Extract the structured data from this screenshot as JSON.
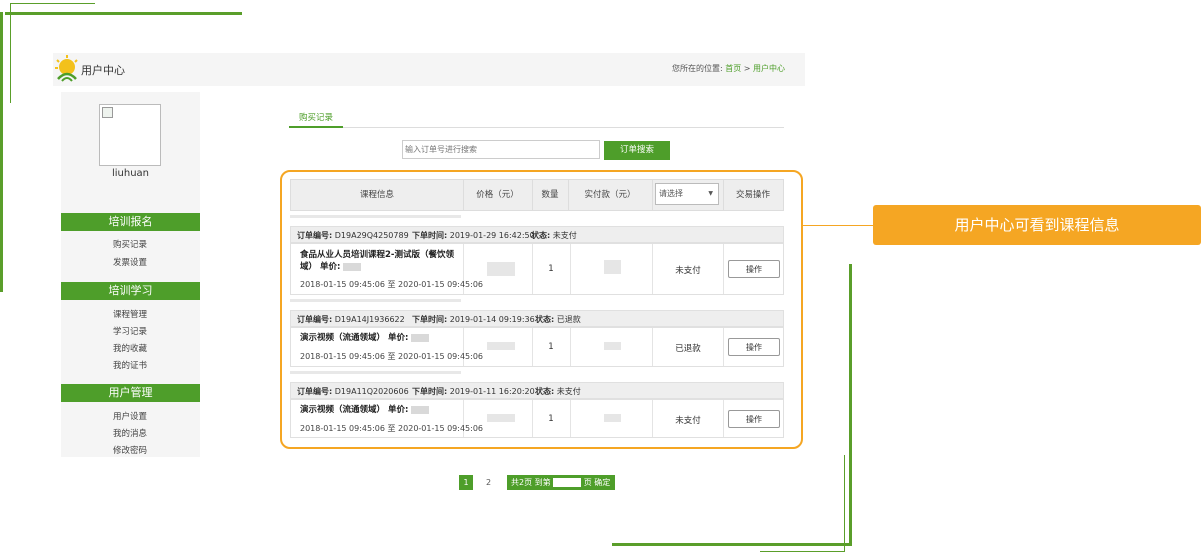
{
  "header": {
    "title": "用户中心",
    "breadcrumb_prefix": "您所在的位置:",
    "breadcrumb_home": "首页",
    "breadcrumb_sep": ">",
    "breadcrumb_current": "用户中心"
  },
  "sidebar": {
    "username": "liuhuan",
    "sections": [
      {
        "title": "培训报名",
        "items": [
          "购买记录",
          "发票设置"
        ]
      },
      {
        "title": "培训学习",
        "items": [
          "课程管理",
          "学习记录",
          "我的收藏",
          "我的证书"
        ]
      },
      {
        "title": "用户管理",
        "items": [
          "用户设置",
          "我的消息",
          "修改密码"
        ]
      }
    ]
  },
  "main": {
    "tab": "购买记录",
    "search_placeholder": "输入订单号进行搜索",
    "search_button": "订单搜索",
    "columns": [
      "课程信息",
      "价格（元）",
      "数量",
      "实付款（元）",
      "请选择",
      "交易操作"
    ],
    "orders": [
      {
        "order_label": "订单编号:",
        "order_no": "D19A29Q4250789",
        "time_label": "下单时间:",
        "time": "2019-01-29 16:42:50",
        "status_label": "状态:",
        "status": "未支付",
        "course_line1": "食品从业人员培训课程2-测试版（餐饮领",
        "course_line2": "域）",
        "unit_label": "单价:",
        "validity": "2018-01-15 09:45:06 至 2020-01-15 09:45:06",
        "qty": "1",
        "pay_status": "未支付",
        "action": "操作"
      },
      {
        "order_label": "订单编号:",
        "order_no": "D19A14J1936622",
        "time_label": "下单时间:",
        "time": "2019-01-14 09:19:36",
        "status_label": "状态:",
        "status": "已退款",
        "course_line1": "演示视频（流通领域）",
        "unit_label": "单价:",
        "validity": "2018-01-15 09:45:06 至 2020-01-15 09:45:06",
        "qty": "1",
        "pay_status": "已退款",
        "action": "操作"
      },
      {
        "order_label": "订单编号:",
        "order_no": "D19A11Q2020606",
        "time_label": "下单时间:",
        "time": "2019-01-11 16:20:20",
        "status_label": "状态:",
        "status": "未支付",
        "course_line1": "演示视频（流通领域）",
        "unit_label": "单价:",
        "validity": "2018-01-15 09:45:06 至 2020-01-15 09:45:06",
        "qty": "1",
        "pay_status": "未支付",
        "action": "操作"
      }
    ]
  },
  "pagination": {
    "current": "1",
    "next": "2",
    "total_text": "共2页 到第",
    "page_suffix": "页 确定"
  },
  "callout": {
    "text": "用户中心可看到课程信息"
  },
  "colors": {
    "brand_green": "#4e9e2a",
    "highlight_orange": "#f5a623"
  }
}
